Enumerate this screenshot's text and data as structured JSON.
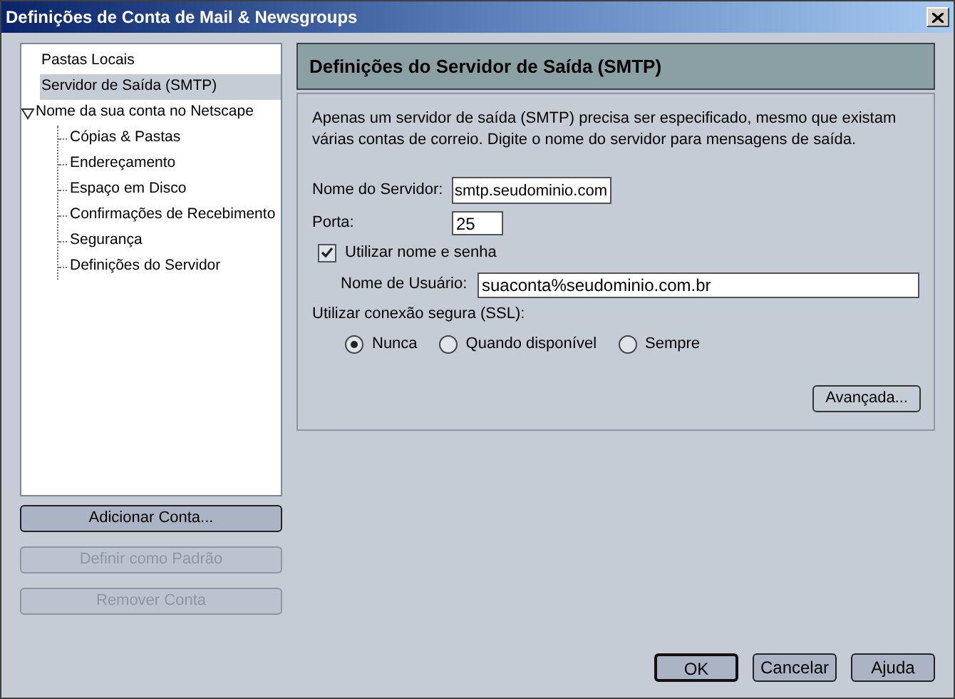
{
  "window": {
    "title": "Definições de Conta de Mail & Newsgroups"
  },
  "account_tree": [
    {
      "label": "Pastas Locais",
      "selected": false
    },
    {
      "label": "Servidor de Saída (SMTP)",
      "selected": true
    },
    {
      "label": "Nome da sua conta no Netscape",
      "selected": false,
      "expanded": true,
      "children": [
        {
          "label": "Cópias & Pastas",
          "selected": false
        },
        {
          "label": "Endereçamento",
          "selected": false
        },
        {
          "label": "Espaço em Disco",
          "selected": false
        },
        {
          "label": "Confirmações de Recebimento",
          "selected": false
        },
        {
          "label": "Segurança",
          "selected": false
        },
        {
          "label": "Definições do Servidor",
          "selected": false
        }
      ]
    }
  ],
  "account_buttons": [
    {
      "label": "Adicionar Conta...",
      "disabled": false
    },
    {
      "label": "Definir como Padrão",
      "disabled": true
    },
    {
      "label": "Remover Conta",
      "disabled": true
    }
  ],
  "panel": {
    "title": "Definições do Servidor de Saída (SMTP)",
    "description": "Apenas um servidor de saída (SMTP) precisa ser especificado, mesmo que existam várias contas de correio. Digite o nome do servidor para mensagens de saída.",
    "server_name": {
      "label": "Nome do Servidor:",
      "value": "smtp.seudominio.com"
    },
    "port": {
      "label": "Porta:",
      "value": "25"
    },
    "use_name_password": {
      "label": "Utilizar nome e senha",
      "checked": true
    },
    "username": {
      "label": "Nome de Usuário:",
      "value": "suaconta%seudominio.com.br"
    },
    "ssl": {
      "label": "Utilizar conexão segura (SSL):",
      "options": [
        {
          "label": "Nunca",
          "selected": true
        },
        {
          "label": "Quando disponível",
          "selected": false
        },
        {
          "label": "Sempre",
          "selected": false
        }
      ]
    },
    "advanced_button": "Avançada..."
  },
  "dialog_buttons": [
    {
      "label": "OK",
      "default": true
    },
    {
      "label": "Cancelar",
      "default": false
    },
    {
      "label": "Ajuda",
      "default": false
    }
  ]
}
